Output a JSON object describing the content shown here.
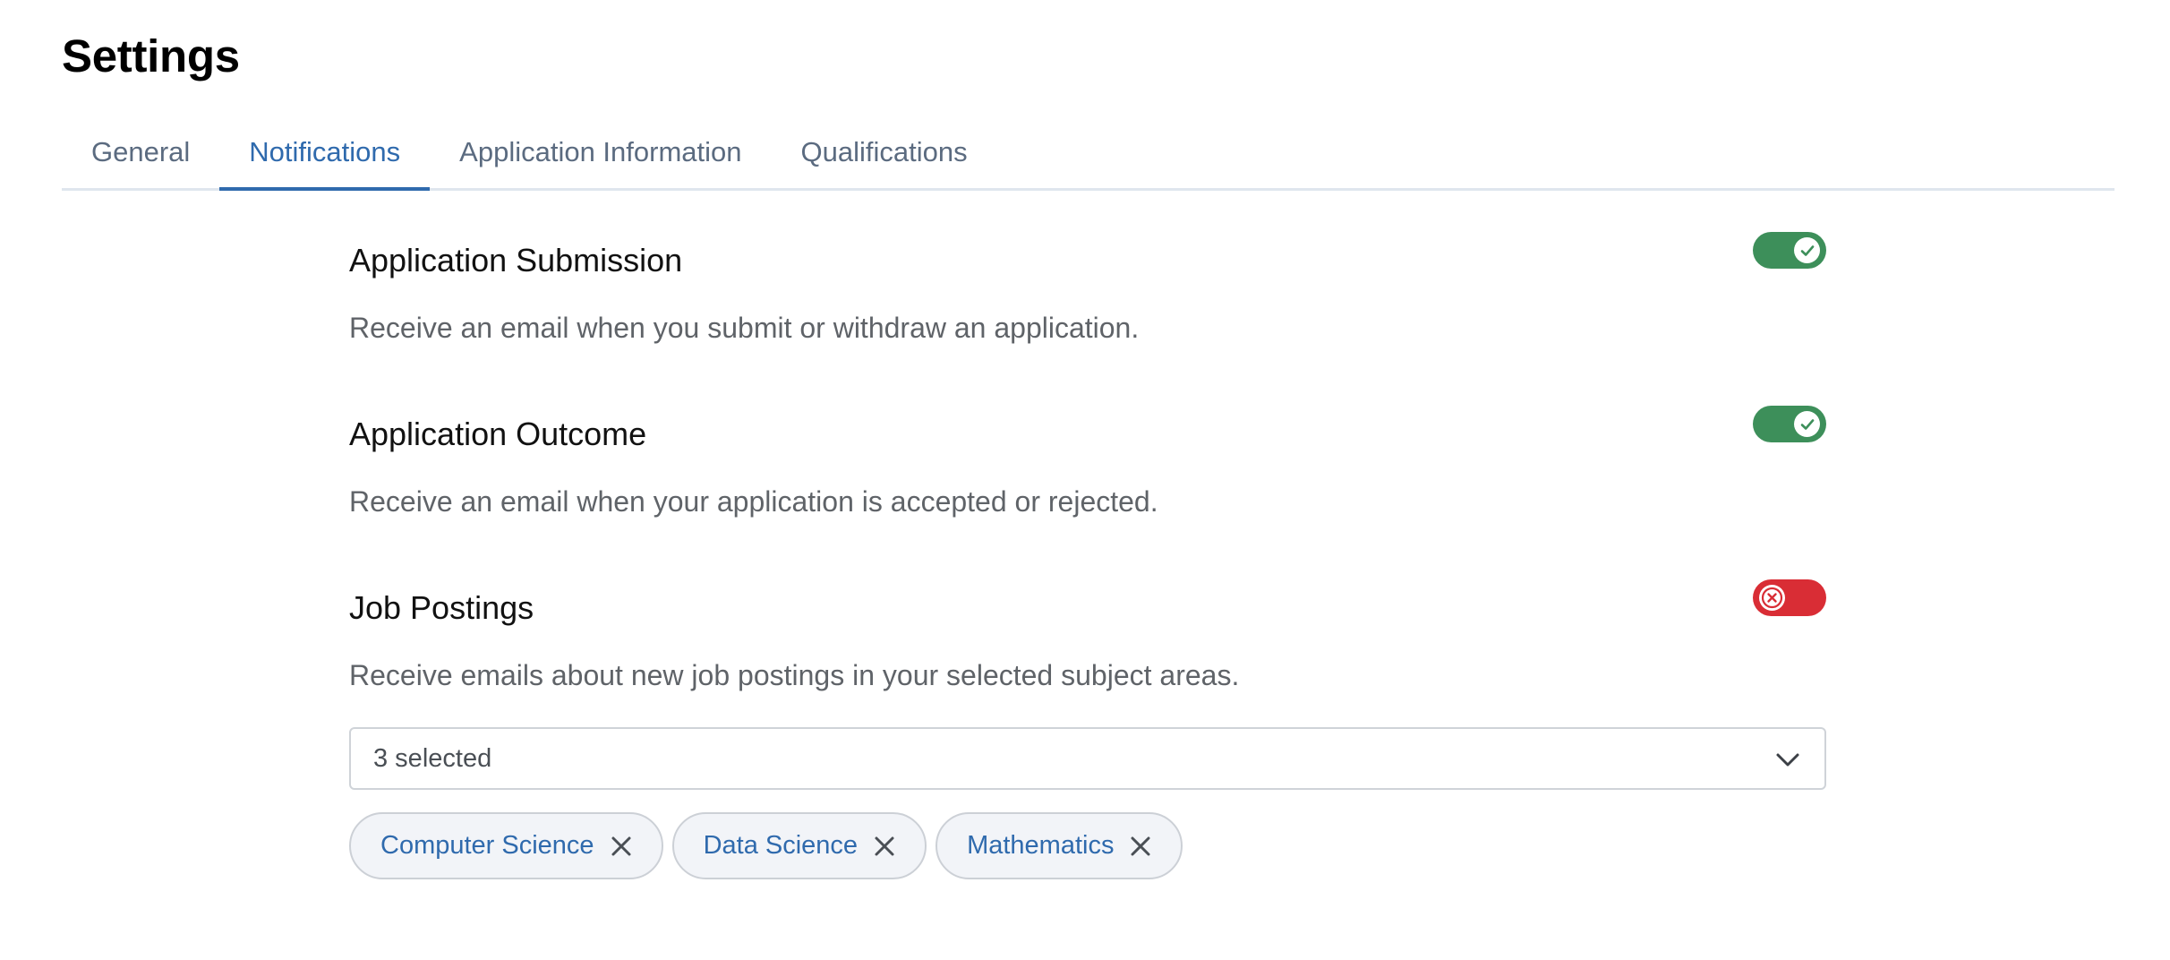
{
  "page": {
    "title": "Settings"
  },
  "tabs": [
    {
      "label": "General",
      "active": false
    },
    {
      "label": "Notifications",
      "active": true
    },
    {
      "label": "Application Information",
      "active": false
    },
    {
      "label": "Qualifications",
      "active": false
    }
  ],
  "notifications": {
    "submission": {
      "title": "Application Submission",
      "description": "Receive an email when you submit or withdraw an application.",
      "enabled": true
    },
    "outcome": {
      "title": "Application Outcome",
      "description": "Receive an email when your application is accepted or rejected.",
      "enabled": true
    },
    "postings": {
      "title": "Job Postings",
      "description": "Receive emails about new job postings in your selected subject areas.",
      "enabled": false
    }
  },
  "subjects": {
    "select_value": "3 selected",
    "chips": [
      "Computer Science",
      "Data Science",
      "Mathematics"
    ]
  },
  "colors": {
    "accent": "#2f6aad",
    "toggle_on": "#3d8f5a",
    "toggle_off": "#d92d35",
    "muted_text": "#5f6368"
  },
  "icons": {
    "on": "check-icon",
    "off": "x-icon",
    "select": "chevron-down-icon",
    "chip_remove": "close-icon"
  }
}
